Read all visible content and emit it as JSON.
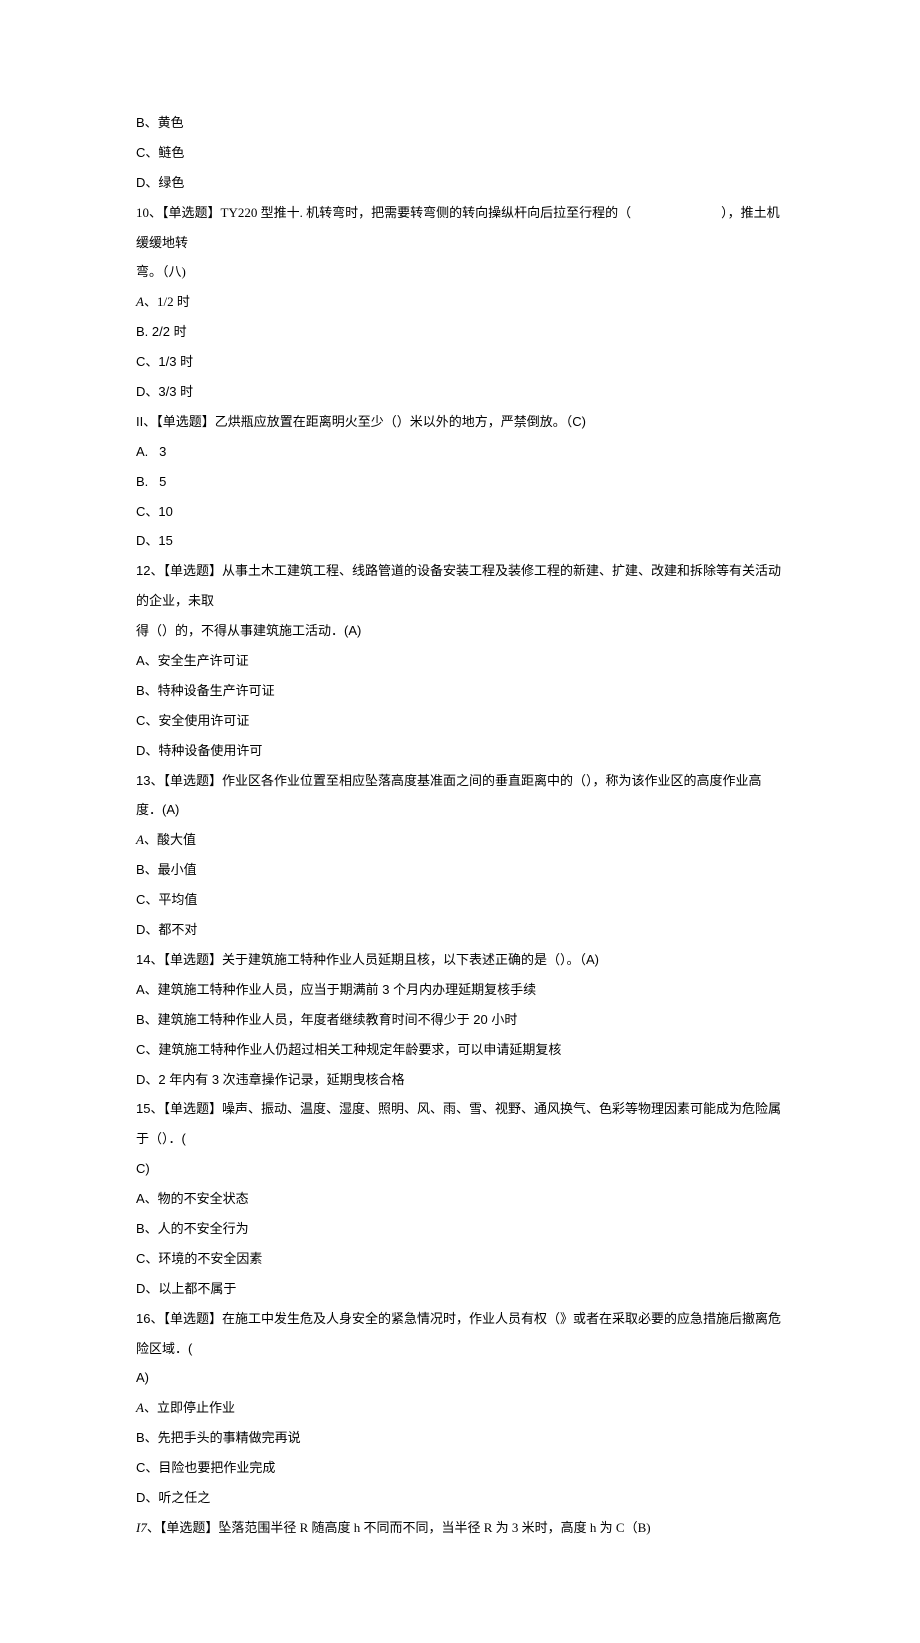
{
  "lines": [
    {
      "cls": "sans",
      "text": "B、黄色"
    },
    {
      "cls": "sans",
      "text": "C、鲢色"
    },
    {
      "cls": "sans",
      "text": "D、绿色"
    },
    {
      "cls": "",
      "text": "10、【单选题】TY220 型推十. 机转弯时，把需要转弯侧的转向操纵杆向后拉至行程的（",
      "tail": "），推土机缓缓地转",
      "gap": true
    },
    {
      "cls": "",
      "text": "弯。（八)"
    },
    {
      "cls": "",
      "html": "<span class=\"italic\">A</span>、1/2 时"
    },
    {
      "cls": "sans",
      "text": "B. 2/2 时"
    },
    {
      "cls": "sans",
      "text": "C、1/3 时"
    },
    {
      "cls": "sans",
      "text": "D、3/3 时"
    },
    {
      "cls": "sans",
      "text": "II、【单选题】乙烘瓶应放置在距离明火至少（）米以外的地方，严禁倒放。（C)"
    },
    {
      "cls": "sans",
      "text": "A.   3"
    },
    {
      "cls": "sans",
      "text": "B.   5"
    },
    {
      "cls": "sans",
      "text": "C、10"
    },
    {
      "cls": "sans",
      "text": "D、15"
    },
    {
      "cls": "sans",
      "text": "12、【单选题】从事土木工建筑工程、线路管道的设备安装工程及装修工程的新建、扩建、改建和拆除等有关活动的企业，未取"
    },
    {
      "cls": "sans",
      "text": "得（）的，不得从事建筑施工活动．(A)"
    },
    {
      "cls": "sans",
      "text": "A、安全生产许可证"
    },
    {
      "cls": "sans",
      "text": "B、特种设备生产许可证"
    },
    {
      "cls": "sans",
      "text": "C、安全使用许可证"
    },
    {
      "cls": "sans",
      "text": "D、特种设备使用许可"
    },
    {
      "cls": "sans",
      "text": "13、【单选题】作业区各作业位置至相应坠落高度基准面之间的垂直距离中的（），称为该作业区的高度作业高"
    },
    {
      "cls": "sans",
      "text": "度．(A)"
    },
    {
      "cls": "",
      "html": "<span class=\"italic\">A</span>、酸大值"
    },
    {
      "cls": "sans",
      "text": "B、最小值"
    },
    {
      "cls": "sans",
      "text": "C、平均值"
    },
    {
      "cls": "sans",
      "text": "D、都不对"
    },
    {
      "cls": "sans",
      "text": "14、【单选题】关于建筑施工特种作业人员延期且核，以下表述正确的是（）。（A)"
    },
    {
      "cls": "sans",
      "text": "A、建筑施工特种作业人员，应当于期满前 3 个月内办理延期复核手续"
    },
    {
      "cls": "sans",
      "text": "B、建筑施工特种作业人员，年度者继续教育时间不得少于 20 小时"
    },
    {
      "cls": "sans",
      "text": "C、建筑施工特种作业人仍超过相关工种规定年龄要求，可以申请延期复核"
    },
    {
      "cls": "sans",
      "text": "D、2 年内有 3 次违章操作记录，延期曳核合格"
    },
    {
      "cls": "sans",
      "text": "15、【单选题】噪声、振动、温度、湿度、照明、风、雨、雪、视野、通风换气、色彩等物理因素可能成为危险属于（）．("
    },
    {
      "cls": "sans",
      "text": "C)"
    },
    {
      "cls": "sans",
      "text": "A、物的不安全状态"
    },
    {
      "cls": "sans",
      "text": "B、人的不安全行为"
    },
    {
      "cls": "sans",
      "text": "C、环境的不安全因素"
    },
    {
      "cls": "sans",
      "text": "D、以上都不属于"
    },
    {
      "cls": "sans",
      "text": "16、【单选题】在施工中发生危及人身安全的紧急情况时，作业人员有权（》或者在采取必要的应急措施后撤离危险区域．("
    },
    {
      "cls": "sans",
      "text": "A)"
    },
    {
      "cls": "",
      "html": "<span class=\"italic\">A</span>、立即停止作业"
    },
    {
      "cls": "sans",
      "text": "B、先把手头的事精做完再说"
    },
    {
      "cls": "sans",
      "text": "C、目险也要把作业完成"
    },
    {
      "cls": "sans",
      "text": "D、听之任之"
    },
    {
      "cls": "",
      "html": "<span class=\"italic\">I7</span>、【单选题】坠落范围半径 R 随高度 h 不同而不同，当半径 R 为 3 米时，高度 h 为 C（B)"
    }
  ]
}
